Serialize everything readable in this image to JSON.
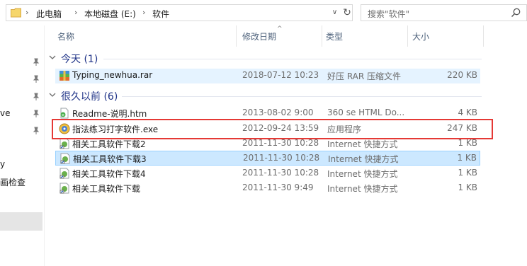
{
  "address_bar": {
    "crumbs": [
      "此电脑",
      "本地磁盘 (E:)",
      "软件"
    ],
    "separator": "›",
    "dropdown_glyph": "∨",
    "refresh_glyph": "↻"
  },
  "search": {
    "placeholder": "搜索\"软件\""
  },
  "nav_pane": {
    "partial_labels": [
      "ve",
      "y",
      "画检查"
    ],
    "pinned_count": 5
  },
  "columns": {
    "name": "名称",
    "date": "修改日期",
    "type": "类型",
    "size": "大小",
    "sort_glyph": "^"
  },
  "groups": [
    {
      "label": "今天 (1)",
      "files": [
        {
          "name": "Typing_newhua.rar",
          "date": "2018-07-12 10:23",
          "type": "好压 RAR 压缩文件",
          "size": "220 KB",
          "icon": "rar-archive-icon"
        }
      ]
    },
    {
      "label": "很久以前 (6)",
      "files": [
        {
          "name": "Readme-说明.htm",
          "date": "2013-08-02 9:00",
          "type": "360 se HTML Do...",
          "size": "4 KB",
          "icon": "html-document-icon"
        },
        {
          "name": "指法练习打字软件.exe",
          "date": "2012-09-24 13:59",
          "type": "应用程序",
          "size": "247 KB",
          "icon": "application-exe-icon"
        },
        {
          "name": "相关工具软件下载2",
          "date": "2011-11-30 10:28",
          "type": "Internet 快捷方式",
          "size": "1 KB",
          "icon": "internet-shortcut-icon"
        },
        {
          "name": "相关工具软件下载3",
          "date": "2011-11-30 10:28",
          "type": "Internet 快捷方式",
          "size": "1 KB",
          "icon": "internet-shortcut-icon"
        },
        {
          "name": "相关工具软件下载4",
          "date": "2011-11-30 10:28",
          "type": "Internet 快捷方式",
          "size": "1 KB",
          "icon": "internet-shortcut-icon"
        },
        {
          "name": "相关工具软件下载",
          "date": "2011-11-30 9:49",
          "type": "Internet 快捷方式",
          "size": "1 KB",
          "icon": "internet-shortcut-icon"
        }
      ]
    }
  ],
  "colors": {
    "selection_fill": "#cce8ff",
    "hover_fill": "#e5f3ff",
    "group_text": "#1e3287",
    "annotation_red": "#e53935"
  }
}
